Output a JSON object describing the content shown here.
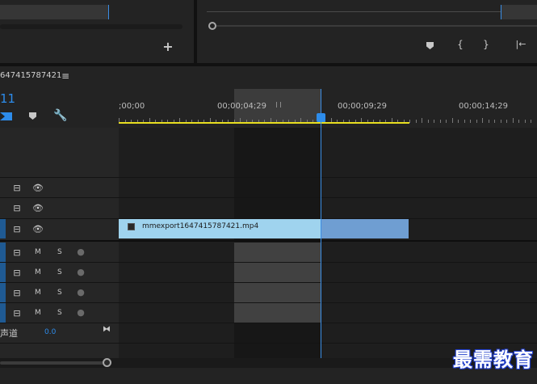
{
  "source_monitor": {
    "add_icon": "plus-icon"
  },
  "program_monitor": {
    "buttons": [
      "add-marker",
      "mark-in",
      "mark-out",
      "go-to-in"
    ]
  },
  "timeline": {
    "sequence_name": "647415787421",
    "menu_icon": "≡",
    "timecode": "11",
    "ruler_labels": [
      ";00;00",
      "00;00;04;29",
      "00;00;09;29",
      "00;00;14;29"
    ],
    "clip": {
      "name": "mmexport1647415787421.mp4"
    },
    "audio_track_buttons": {
      "mute": "M",
      "solo": "S"
    },
    "master": {
      "label": "声道",
      "value": "0.0"
    }
  },
  "watermark": "最需教育",
  "colors": {
    "accent_blue": "#2d8ceb",
    "clip_video": "#9fd3ee",
    "work_area": "#e8de20"
  }
}
